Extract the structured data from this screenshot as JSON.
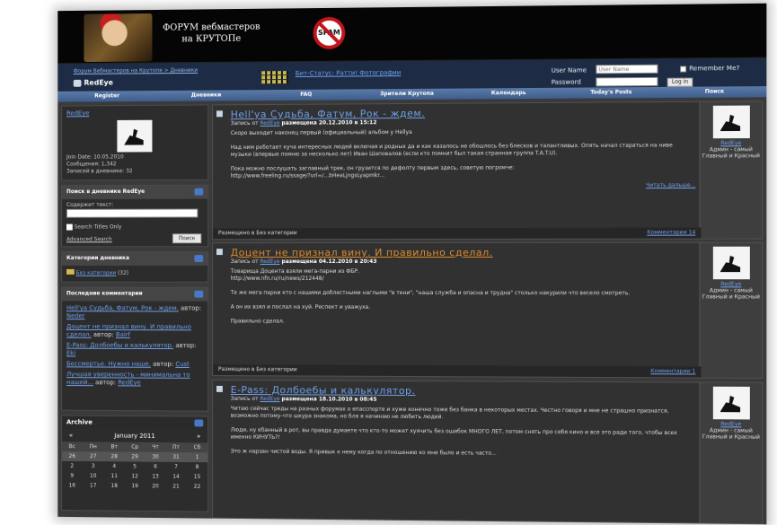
{
  "banner": {
    "title_line1": "ФОРУМ вебмастеров",
    "title_line2": "на КРУТОПе",
    "stamp": "SPAM"
  },
  "infobar": {
    "breadcrumb": "Форум Вебмастеров на Крутопе > Дневники",
    "current_user": "RedEye",
    "stats_link": "Бит-Статус: Ратти! Фотографии",
    "username_label": "User Name",
    "username_placeholder": "User Name",
    "password_label": "Password",
    "remember_label": "Remember Me?",
    "login_button": "Log in"
  },
  "menu": [
    "Register",
    "Дневники",
    "FAQ",
    "Зрители Крутопа",
    "Календарь",
    "Today's Posts",
    "Поиск"
  ],
  "sidebar": {
    "profile": {
      "name": "RedEye",
      "join_date": "Join Date: 10.05.2010",
      "posts": "Сообщения: 1,342",
      "entries": "Записей в дневнике: 32"
    },
    "search": {
      "title": "Поиск в дневнике RedEye",
      "label": "Содержит текст:",
      "titles_only": "Search Titles Only",
      "advanced": "Advanced Search",
      "button": "Поиск"
    },
    "categories": {
      "title": "Категории дневника",
      "item": "Без категории",
      "count": "(32)"
    },
    "comments": {
      "title": "Последние комментарии",
      "items": [
        {
          "link": "Hell'ya Судьба, Фатум, Рок - ждем.",
          "sep": "автор:",
          "author": "Neder"
        },
        {
          "link": "Доцент не признал вину. И правильно сделал.",
          "sep": "автор:",
          "author": "Bairf"
        },
        {
          "link": "E-Pass: Долбоебы и калькулятор.",
          "sep": "автор:",
          "author": "Eki"
        },
        {
          "link": "Бессмертье. Нужно наше.",
          "sep": "автор:",
          "author": "Cust"
        },
        {
          "link": "Лучшая уверенность - минимальна то нашей...",
          "sep": "автор:",
          "author": "RedEye"
        }
      ]
    },
    "archive": {
      "title": "Archive",
      "month": "January 2011",
      "prev": "«",
      "next": "»",
      "weekdays": [
        "Вс",
        "Пн",
        "Вт",
        "Ср",
        "Чт",
        "Пт",
        "Сб"
      ],
      "weeks": [
        [
          "26",
          "27",
          "28",
          "29",
          "30",
          "31",
          "1"
        ],
        [
          "2",
          "3",
          "4",
          "5",
          "6",
          "7",
          "8"
        ],
        [
          "9",
          "10",
          "11",
          "12",
          "13",
          "14",
          "15"
        ],
        [
          "16",
          "17",
          "18",
          "19",
          "20",
          "21",
          "22"
        ]
      ]
    }
  },
  "posts": [
    {
      "title": "Hell'ya Судьба, Фатум, Рок - ждем.",
      "title_color": "#6fa0ea",
      "meta_prefix": "Запись от",
      "author": "RedEye",
      "meta_date": "размещена 20.12.2010 в 15:12",
      "text": "Скоро выходит наконец первый (официальный) альбом у Hellya\n\nНад ним работает куча интересных людей включая и родных да и как казалось не обошлось без блесков и талантливых. Опять начал стараться на ниве музыки (впервые помню за несколько лет) Иван Шаповалов (если кто помнит был такая странная группа T.A.T.U).\n\nПока можно послушать заглавный трек, он грузится по дефолту первым здесь, советую погромче:\nhttp://www.freeling.ru/ssage/?url=/...bHeaLjngsLyapmkr...",
      "read_more": "Читать дальше...",
      "footer": "Размещено в Без категории",
      "comments": "Комментарии 14",
      "role": "Админ - самый Главный и Красный"
    },
    {
      "title": "Доцент не признал вину. И правильно сделал.",
      "title_color": "#e08a2a",
      "meta_prefix": "Запись от",
      "author": "RedEye",
      "meta_date": "размещена 04.12.2010 в 20:43",
      "text": "Товарища Доцента взяли мега-парни из ФБР.\nhttp://www.nfn.ru/ru/news/212448/\n\nТе же мега парни кто с нашими доблестными наглыми \"в тени\", \"наша служба и опасна и трудна\" столько накурили что весело смотреть.\n\nА он их взял и послал на хуй. Респект и уважуха.\n\nПравильно сделал.",
      "footer": "Размещено в Без категории",
      "comments": "Комментарии 1",
      "role": "Админ - самый Главный и Красный"
    },
    {
      "title": "E-Pass: Долбоебы и калькулятор.",
      "title_color": "#6fa0ea",
      "meta_prefix": "Запись от",
      "author": "RedEye",
      "meta_date": "размещена 18.10.2010 в 08:45",
      "text": "Читаю сейчас треды на разных форумах о епасспорте и хуже конечно тоже без банка в некоторых местах. Честно говоря и мне не страшно признатся, возможно потому-что шкура знакома, но бля я начинаю не любить людей.\n\nЛюди, ну ебанный в рот, вы правда думаете что кто-то может хуячить без ошибок МНОГО ЛЕТ, потом снять про себя кино и все это ради того, чтобы всех именно КИНУТЬ?!\n\nЭто ж нарзан чистой воды. Я привык к нему когда по отношению ко мне было и есть часто...",
      "role": "Админ - самый Главный и Красный"
    }
  ]
}
